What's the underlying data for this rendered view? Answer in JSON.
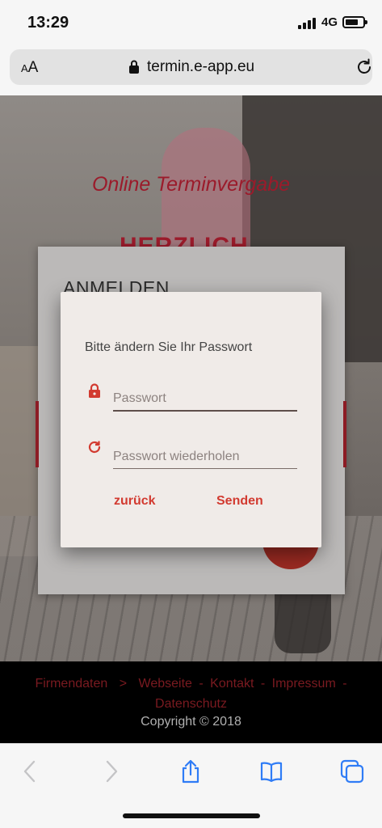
{
  "status_bar": {
    "time": "13:29",
    "network": "4G"
  },
  "address_bar": {
    "text_size_label": "AA",
    "url": "termin.e-app.eu"
  },
  "page": {
    "headline": "Online Terminvergabe",
    "welcome_partial": "HERZLICH",
    "login_title": "ANMELDEN"
  },
  "dialog": {
    "title": "Bitte ändern Sie Ihr Passwort",
    "password_placeholder": "Passwort",
    "repeat_placeholder": "Passwort wiederholen",
    "back_label": "zurück",
    "send_label": "Senden"
  },
  "footer": {
    "company_data": "Firmendaten",
    "separator": ">",
    "website": "Webseite",
    "contact": "Kontakt",
    "imprint": "Impressum",
    "privacy": "Datenschutz",
    "dash": "-",
    "copyright": "Copyright © 2018"
  },
  "colors": {
    "accent": "#d23a30",
    "brand": "#9b1b2b",
    "footer_link": "#7a1a20",
    "ios_blue": "#2f7cf6"
  },
  "toolbar": {
    "icons": [
      "back-icon",
      "forward-icon",
      "share-icon",
      "bookmarks-icon",
      "tabs-icon"
    ]
  }
}
